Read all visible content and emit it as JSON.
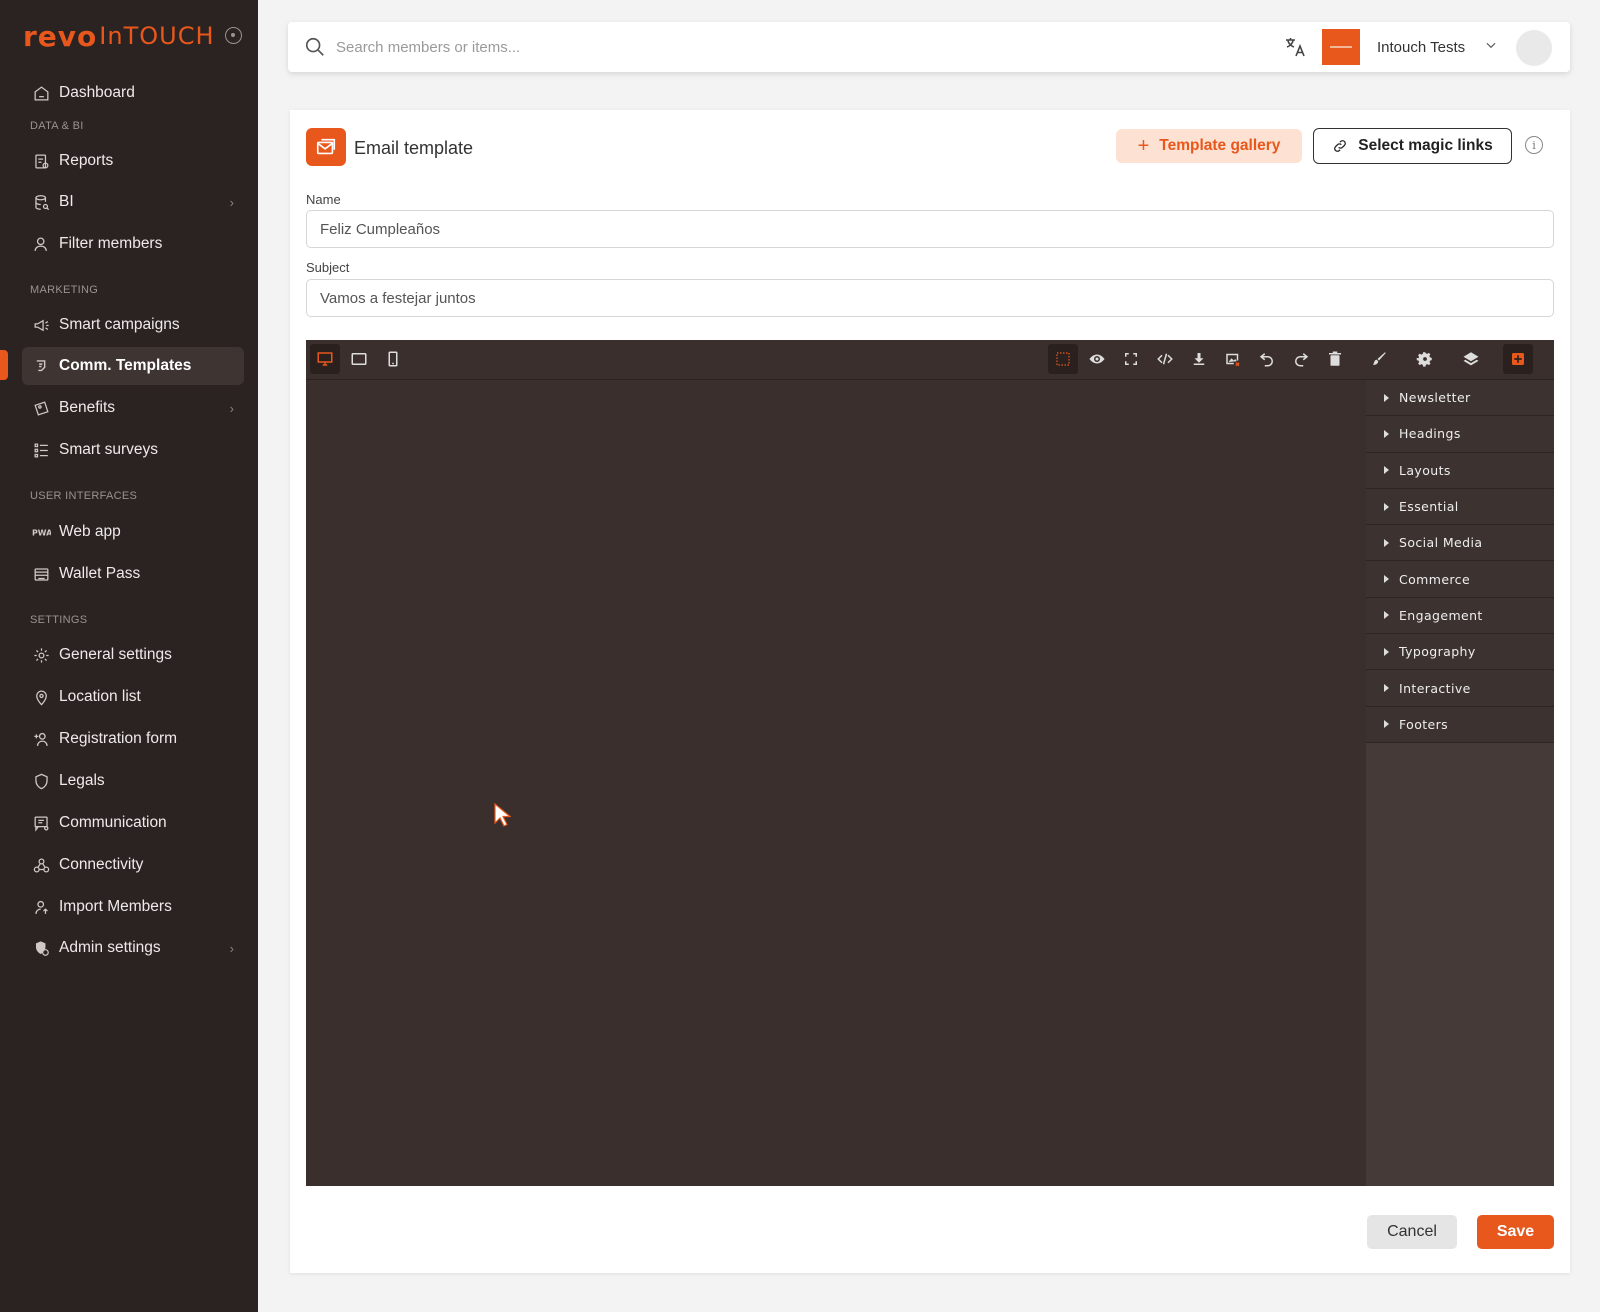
{
  "brand": {
    "logo_primary": "revo",
    "logo_secondary": "InTOUCH",
    "accent": "#e8571c"
  },
  "sidebar": {
    "sections": {
      "data_bi": "DATA & BI",
      "marketing": "MARKETING",
      "user_interfaces": "USER INTERFACES",
      "settings": "SETTINGS"
    },
    "items": {
      "dashboard": "Dashboard",
      "reports": "Reports",
      "bi": "BI",
      "filter_members": "Filter members",
      "smart_campaigns": "Smart campaigns",
      "comm_templates": "Comm. Templates",
      "benefits": "Benefits",
      "smart_surveys": "Smart surveys",
      "web_app": "Web app",
      "wallet_pass": "Wallet Pass",
      "general_settings": "General settings",
      "location_list": "Location list",
      "registration_form": "Registration form",
      "legals": "Legals",
      "communication": "Communication",
      "connectivity": "Connectivity",
      "import_members": "Import Members",
      "admin_settings": "Admin settings"
    },
    "active": "comm_templates"
  },
  "topbar": {
    "search_placeholder": "Search members or items...",
    "account_name": "Intouch Tests"
  },
  "card": {
    "title": "Email template",
    "gallery_label": "Template gallery",
    "magic_links_label": "Select magic links",
    "name_label": "Name",
    "name_value": "Feliz Cumpleaños",
    "subject_label": "Subject",
    "subject_value": "Vamos a festejar juntos"
  },
  "editor": {
    "device_icons": [
      "desktop-icon",
      "tablet-icon",
      "mobile-icon"
    ],
    "toolbar_icons": [
      "outline-icon",
      "preview-icon",
      "fullscreen-icon",
      "code-icon",
      "download-icon",
      "clear-images-icon",
      "undo-icon",
      "redo-icon",
      "trash-icon",
      "style-brush-icon",
      "settings-gear-icon",
      "layers-icon",
      "add-block-icon"
    ],
    "block_categories": [
      "Newsletter",
      "Headings",
      "Layouts",
      "Essential",
      "Social Media",
      "Commerce",
      "Engagement",
      "Typography",
      "Interactive",
      "Footers"
    ]
  },
  "footer": {
    "cancel_label": "Cancel",
    "save_label": "Save"
  }
}
